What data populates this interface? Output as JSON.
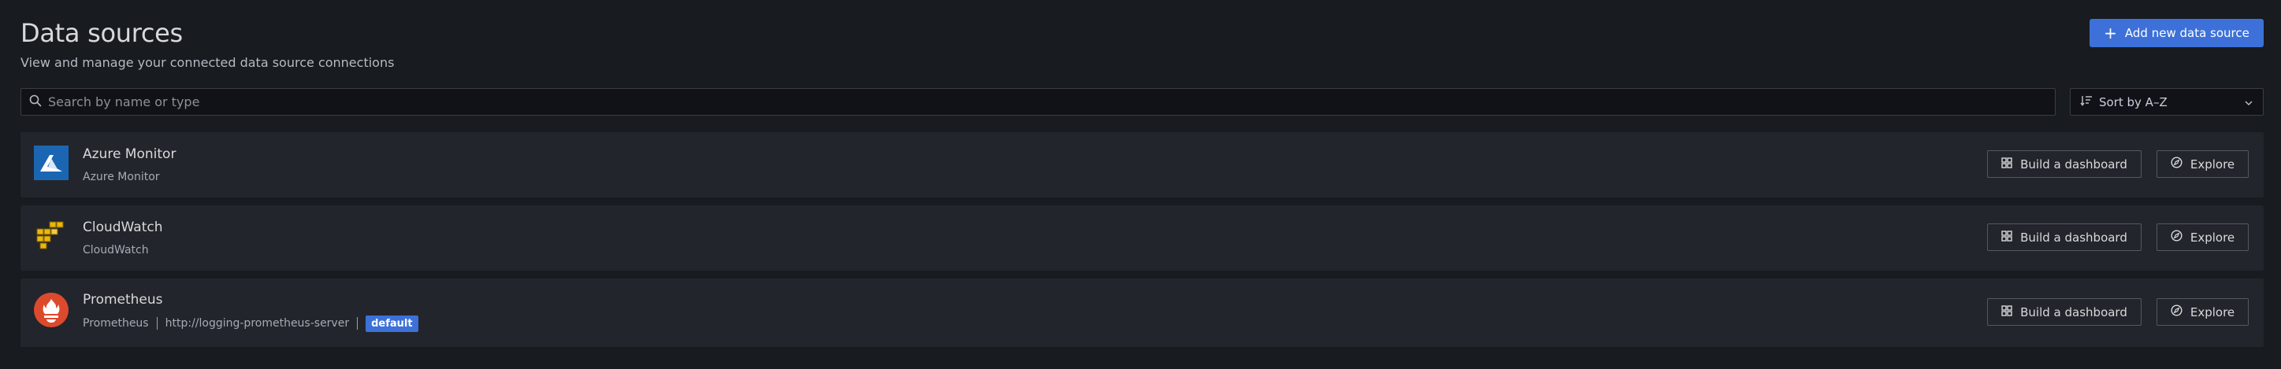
{
  "page": {
    "title": "Data sources",
    "subtitle": "View and manage your connected data source connections"
  },
  "actions": {
    "add_label": "Add new data source"
  },
  "filters": {
    "search_placeholder": "Search by name or type",
    "sort_label": "Sort by A–Z"
  },
  "datasources": [
    {
      "name": "Azure Monitor",
      "type": "Azure Monitor",
      "logo_icon": "azure-monitor-logo",
      "build_label": "Build a dashboard",
      "explore_label": "Explore"
    },
    {
      "name": "CloudWatch",
      "type": "CloudWatch",
      "logo_icon": "cloudwatch-logo",
      "build_label": "Build a dashboard",
      "explore_label": "Explore"
    },
    {
      "name": "Prometheus",
      "type": "Prometheus",
      "url": "http://logging-prometheus-server",
      "badge": "default",
      "logo_icon": "prometheus-logo",
      "build_label": "Build a dashboard",
      "explore_label": "Explore"
    }
  ],
  "colors": {
    "background": "#181b1f",
    "card": "#22252b",
    "primary": "#3d71d9",
    "azure": "#1b66b3",
    "cloudwatch": "#e8b80f",
    "prometheus": "#dc4a2e"
  }
}
